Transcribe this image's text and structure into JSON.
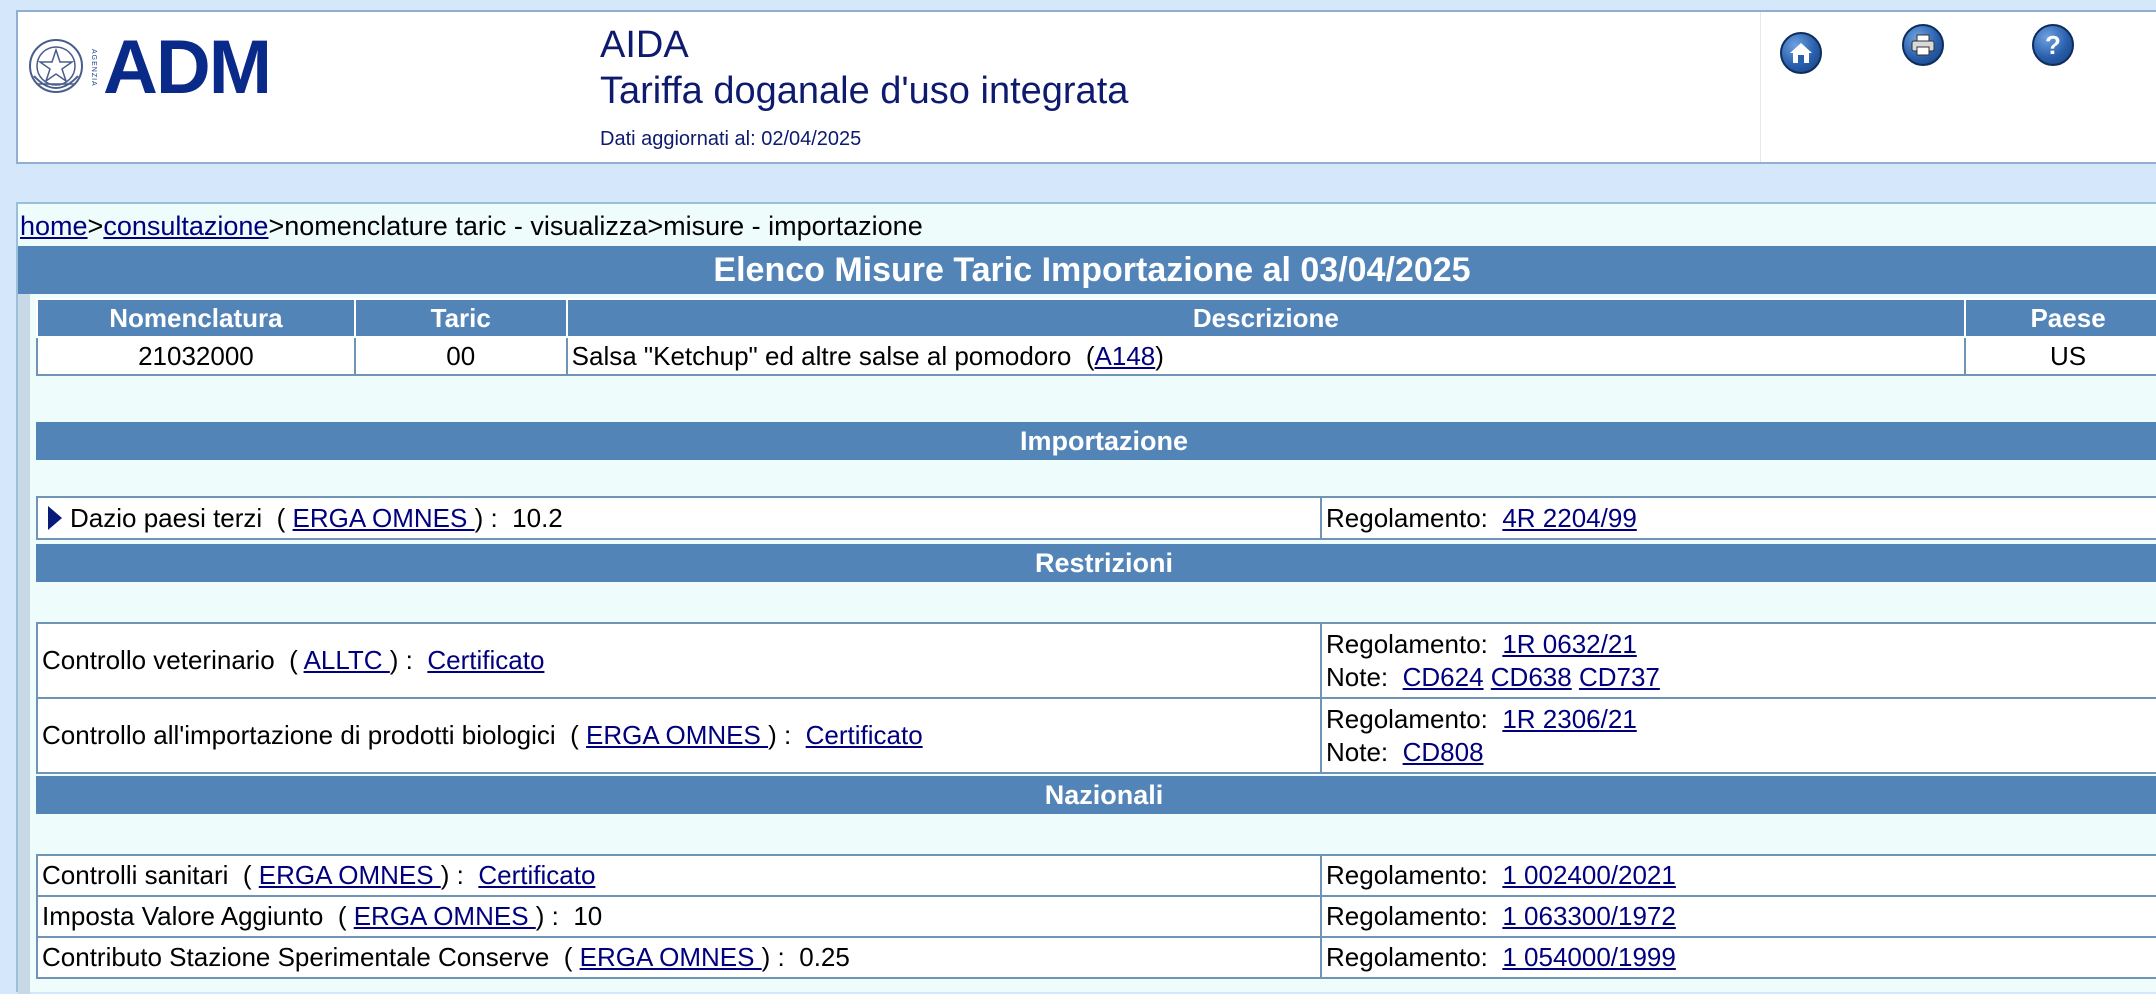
{
  "header": {
    "logo_text": "ADM",
    "agenzia_vertical": "AGENZIA",
    "app_name": "AIDA",
    "app_subtitle": "Tariffa doganale d'uso integrata",
    "updated": "Dati aggiornati al: 02/04/2025"
  },
  "breadcrumb": {
    "home": "home",
    "sep": ">",
    "consultazione": "consultazione",
    "rest": ">nomenclature taric - visualizza>misure - importazione"
  },
  "page_title": "Elenco Misure Taric Importazione al 03/04/2025",
  "nomenclature_table": {
    "headers": [
      "Nomenclatura",
      "Taric",
      "Descrizione",
      "Paese"
    ],
    "row": {
      "nomenclatura": "21032000",
      "taric": "00",
      "descrizione": "Salsa \"Ketchup\" ed altre salse al pomodoro",
      "footnote": "A148",
      "paese": "US"
    }
  },
  "sections": {
    "importazione": "Importazione",
    "restrizioni": "Restrizioni",
    "nazionali": "Nazionali"
  },
  "labels": {
    "regolamento": "Regolamento:",
    "note": "Note:"
  },
  "importazione_rows": [
    {
      "name": "Dazio paesi terzi",
      "area": "ERGA OMNES ",
      "value": "10.2",
      "regolamento": "4R 2204/99 "
    }
  ],
  "restrizioni_rows": [
    {
      "name": "Controllo veterinario",
      "area": "ALLTC ",
      "value": "Certificato",
      "regolamento": "1R 0632/21 ",
      "notes": [
        "CD624",
        "CD638",
        "CD737"
      ]
    },
    {
      "name": "Controllo all'importazione di prodotti biologici",
      "area": "ERGA OMNES ",
      "value": "Certificato",
      "regolamento": "1R 2306/21 ",
      "notes": [
        "CD808"
      ]
    }
  ],
  "nazionali_rows": [
    {
      "name": "Controlli sanitari",
      "area": "ERGA OMNES ",
      "value": "Certificato",
      "regolamento": "1 002400/2021"
    },
    {
      "name": "Imposta Valore Aggiunto",
      "area": "ERGA OMNES ",
      "value": "10",
      "regolamento": "1 063300/1972"
    },
    {
      "name": "Contributo Stazione Sperimentale Conserve",
      "area": "ERGA OMNES ",
      "value": "0.25",
      "regolamento": "1 054000/1999"
    }
  ],
  "colors": {
    "header_bar": "#5284b8",
    "page_bg": "#d5e8fb",
    "panel_bg": "#eefcfb",
    "link": "#00007f",
    "logo_blue": "#0a2a8a"
  }
}
